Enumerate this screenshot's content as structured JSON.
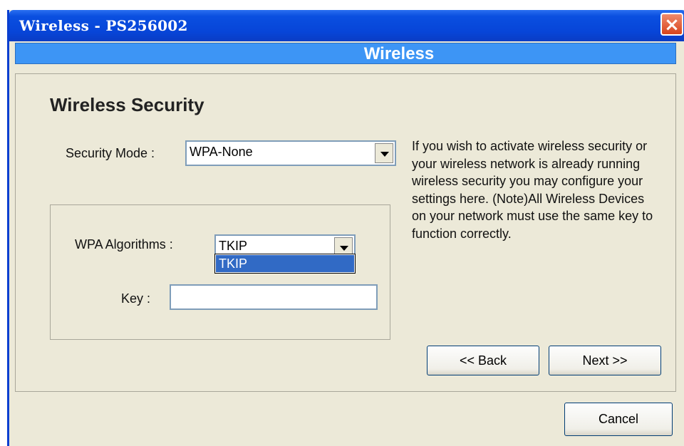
{
  "window": {
    "title": "Wireless - PS256002",
    "close_symbol": "×"
  },
  "banner": {
    "title": "Wireless"
  },
  "section": {
    "heading": "Wireless Security"
  },
  "security_mode": {
    "label": "Security Mode :",
    "selected": "WPA-None"
  },
  "wpa": {
    "algorithms_label": "WPA Algorithms :",
    "selected": "TKIP",
    "options": [
      "TKIP"
    ],
    "key_label": "Key :",
    "key_value": ""
  },
  "help": {
    "text": "If you wish to activate wireless security or your wireless network is already running wireless security you may configure your settings here. (Note)All Wireless Devices on your network must use the same key to function correctly."
  },
  "buttons": {
    "back": "<< Back",
    "next": "Next >>",
    "cancel": "Cancel"
  },
  "colors": {
    "titlebar": "#0745d8",
    "banner": "#3d95f5",
    "dialog_bg": "#ece9d8",
    "selection": "#316ac5"
  }
}
